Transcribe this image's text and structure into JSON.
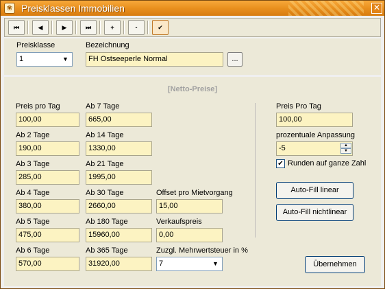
{
  "window": {
    "title": "Preisklassen Immobilien",
    "close": "✕"
  },
  "toolbar": {
    "first": "⏮",
    "prev": "◀",
    "next": "▶",
    "last": "⏭",
    "add": "+",
    "remove": "-",
    "confirm": "✔"
  },
  "header": {
    "preisklasse_label": "Preisklasse",
    "preisklasse_value": "1",
    "bezeichnung_label": "Bezeichnung",
    "bezeichnung_value": "FH Ostseeperle Normal",
    "browse_label": "..."
  },
  "section_title": "[Netto-Preise]",
  "prices": {
    "col1": [
      {
        "label": "Preis pro Tag",
        "value": "100,00"
      },
      {
        "label": "Ab 2 Tage",
        "value": "190,00"
      },
      {
        "label": "Ab 3 Tage",
        "value": "285,00"
      },
      {
        "label": "Ab 4 Tage",
        "value": "380,00"
      },
      {
        "label": "Ab 5 Tage",
        "value": "475,00"
      },
      {
        "label": "Ab 6 Tage",
        "value": "570,00"
      }
    ],
    "col2": [
      {
        "label": "Ab 7 Tage",
        "value": "665,00"
      },
      {
        "label": "Ab 14 Tage",
        "value": "1330,00"
      },
      {
        "label": "Ab 21 Tage",
        "value": "1995,00"
      },
      {
        "label": "Ab 30 Tage",
        "value": "2660,00"
      },
      {
        "label": "Ab 180 Tage",
        "value": "15960,00"
      },
      {
        "label": "Ab 365 Tage",
        "value": "31920,00"
      }
    ],
    "offset_label": "Offset pro Mietvorgang",
    "offset_value": "15,00",
    "verkauf_label": "Verkaufspreis",
    "verkauf_value": "0,00",
    "mwst_label": "Zuzgl. Mehrwertsteuer in %",
    "mwst_value": "7"
  },
  "right": {
    "preis_label": "Preis Pro Tag",
    "preis_value": "100,00",
    "anpassung_label": "prozentuale Anpassung",
    "anpassung_value": "-5",
    "runden_label": "Runden auf ganze Zahl",
    "runden_checked": "✔",
    "autofill_linear": "Auto-Fill linear",
    "autofill_nonlinear": "Auto-Fill nichtlinear",
    "apply": "Übernehmen"
  }
}
